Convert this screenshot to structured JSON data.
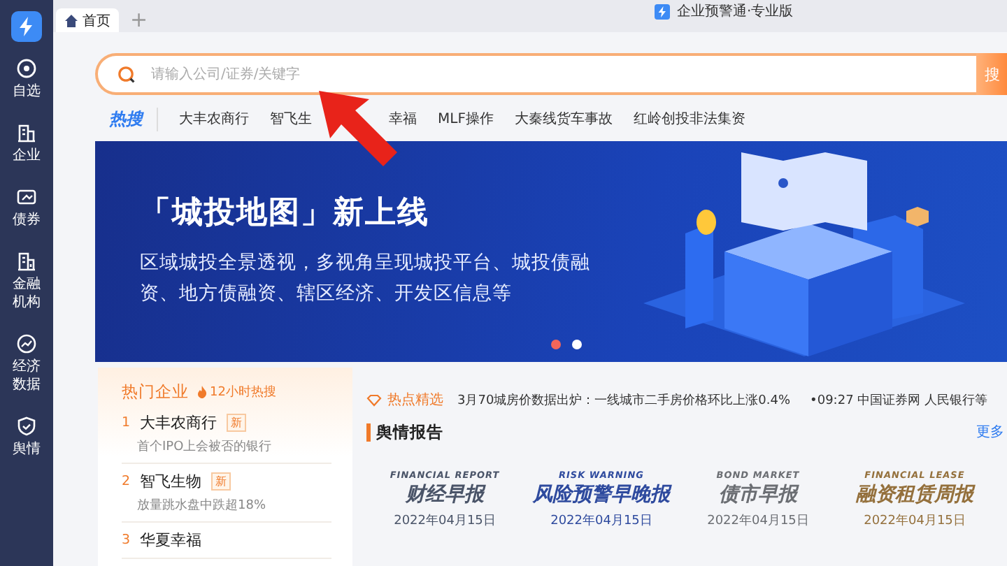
{
  "app": {
    "title": "企业预警通·专业版"
  },
  "sidebar": {
    "items": [
      {
        "label": "自选"
      },
      {
        "label": "企业"
      },
      {
        "label": "债券"
      },
      {
        "label": "金融机构"
      },
      {
        "label": "经济数据"
      },
      {
        "label": "舆情"
      }
    ]
  },
  "tabs": [
    {
      "label": "首页",
      "selected": true
    }
  ],
  "new_tab": "+",
  "search": {
    "placeholder": "请输入公司/证券/关键字",
    "button": "搜"
  },
  "hot_search": {
    "label": "热搜",
    "items": [
      "大丰农商行",
      "智飞生",
      "幸福",
      "MLF操作",
      "大秦线货车事故",
      "红岭创投非法集资"
    ]
  },
  "banner": {
    "title": "「城投地图」新上线",
    "description": "区域城投全景透视，多视角呈现城投平台、城投债融资、地方债融资、辖区经济、开发区信息等",
    "dots": [
      {
        "selected": true
      },
      {
        "selected": false
      }
    ]
  },
  "hot_companies": {
    "title": "热门企业",
    "badge": "12小时热搜",
    "items": [
      {
        "rank": "1",
        "name": "大丰农商行",
        "tag": "新",
        "note": "首个IPO上会被否的银行"
      },
      {
        "rank": "2",
        "name": "智飞生物",
        "tag": "新",
        "note": "放量跳水盘中跌超18%"
      },
      {
        "rank": "3",
        "name": "华夏幸福"
      }
    ]
  },
  "ticker": {
    "label": "热点精选",
    "items": [
      "3月70城房价数据出炉：一线城市二手房价格环比上涨0.4%",
      "•09:27 中国证券网  人民银行等"
    ]
  },
  "reports": {
    "title": "舆情报告",
    "more": "更多",
    "items": [
      {
        "english": "FINANCIAL REPORT",
        "name": "财经早报",
        "date": "2022年04月15日",
        "color": "#4a5468"
      },
      {
        "english": "RISK WARNING",
        "name": "风险预警早晚报",
        "date": "2022年04月15日",
        "color": "#2e4a9e"
      },
      {
        "english": "BOND MARKET",
        "name": "债市早报",
        "date": "2022年04月15日",
        "color": "#6b6e73"
      },
      {
        "english": "FINANCIAL LEASE",
        "name": "融资租赁周报",
        "date": "2022年04月15日",
        "color": "#94703c"
      }
    ]
  }
}
